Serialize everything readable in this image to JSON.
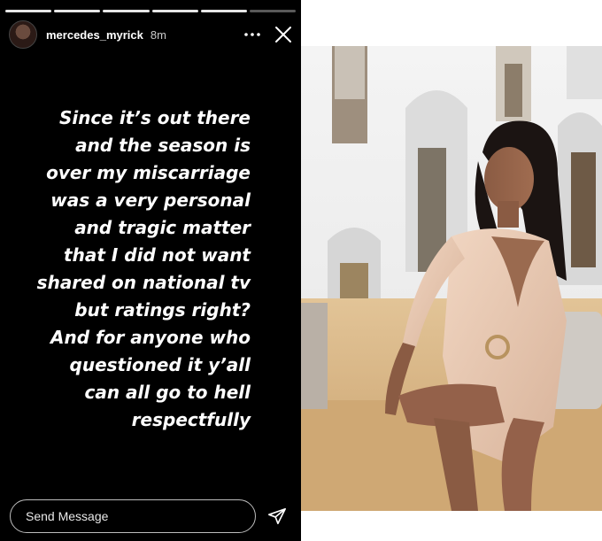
{
  "story": {
    "username": "mercedes_myrick",
    "time_ago": "8m",
    "progress_total": 6,
    "progress_current": 5,
    "text_lines": [
      "Since it’s out there",
      "and the season is",
      "over my miscarriage",
      "was a very personal",
      "and tragic matter",
      "that I did not want",
      "shared on national tv",
      "but ratings right?",
      "And for anyone who",
      "questioned it y’all",
      "can all go to hell",
      "respectfully"
    ],
    "reply_placeholder": "Send Message",
    "icons": {
      "more": "more-horizontal-icon",
      "close": "close-icon",
      "send": "send-paper-plane-icon",
      "avatar": "profile-avatar"
    }
  },
  "colors": {
    "story_bg": "#000000",
    "text": "#ffffff",
    "wall": "#efefef",
    "couch": "#d8b688",
    "dress": "#e8c8b2"
  }
}
